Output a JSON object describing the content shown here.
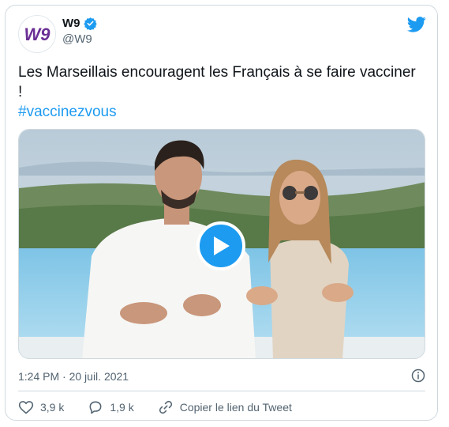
{
  "author": {
    "avatar_text": "W9",
    "name": "W9",
    "handle": "@W9",
    "verified": true
  },
  "tweet": {
    "text": "Les Marseillais encouragent les Français à se faire vacciner !",
    "hashtag": "#vaccinezvous"
  },
  "meta": {
    "timestamp": "1:24 PM · 20 juil. 2021"
  },
  "actions": {
    "likes": "3,9 k",
    "replies": "1,9 k",
    "copy_link": "Copier le lien du Tweet"
  },
  "icons": {
    "brand": "twitter-bird-icon",
    "verified": "verified-badge-icon",
    "play": "play-icon",
    "info": "info-icon",
    "like": "heart-icon",
    "reply": "reply-bubble-icon",
    "link": "link-icon"
  },
  "colors": {
    "accent": "#1d9bf0",
    "avatar_brand": "#6b2f95",
    "text_primary": "#0f1419",
    "text_secondary": "#536471",
    "border": "#cfd9de"
  }
}
